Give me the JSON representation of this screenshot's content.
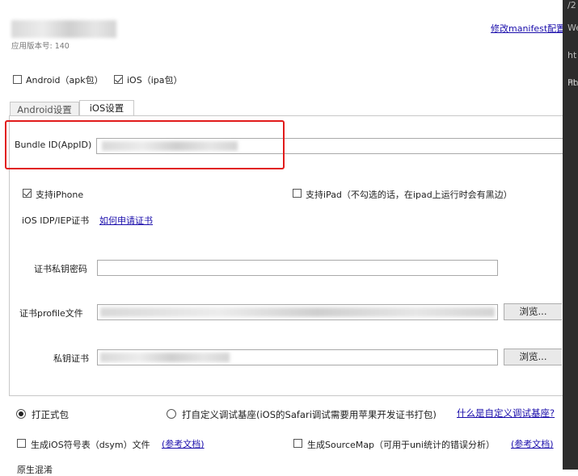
{
  "header": {
    "version_label": "应用版本号: 140",
    "manifest_link": "修改manifest配置"
  },
  "packages": {
    "android": {
      "label": "Android（apk包）",
      "checked": false
    },
    "ios": {
      "label": "iOS（ipa包）",
      "checked": true
    }
  },
  "tabs": [
    {
      "label": "Android设置",
      "active": false
    },
    {
      "label": "iOS设置",
      "active": true
    }
  ],
  "ios": {
    "bundle_id_label": "Bundle ID(AppID)",
    "support_iphone": {
      "label": "支持iPhone",
      "checked": true
    },
    "support_ipad": {
      "label": "支持iPad（不勾选的话，在ipad上运行时会有黑边）",
      "checked": false
    },
    "cert_label": "iOS IDP/IEP证书",
    "cert_link": "如何申请证书",
    "private_key_password_label": "证书私钥密码",
    "profile_label": "证书profile文件",
    "private_key_label": "私钥证书",
    "browse_button": "浏览..."
  },
  "build": {
    "formal": {
      "label": "打正式包",
      "checked": true
    },
    "custom": {
      "label": "打自定义调试基座(iOS的Safari调试需要用苹果开发证书打包)",
      "checked": false
    },
    "custom_link": "什么是自定义调试基座?",
    "dsym": {
      "label": "生成iOS符号表（dsym）文件",
      "checked": false
    },
    "dsym_link": "(参考文档)",
    "sourcemap": {
      "label": "生成SourceMap（可用于uni统计的错误分析）",
      "checked": false
    },
    "sourcemap_link": "(参考文档)",
    "bottom_partial": "原生混淆"
  },
  "right_strip_fragments": [
    "/2",
    "We",
    "ht",
    "ht",
    "Ph"
  ],
  "colors": {
    "highlight_box": "#e11b1b",
    "link": "#1a0dab",
    "right_strip": "#2c2c2c"
  }
}
